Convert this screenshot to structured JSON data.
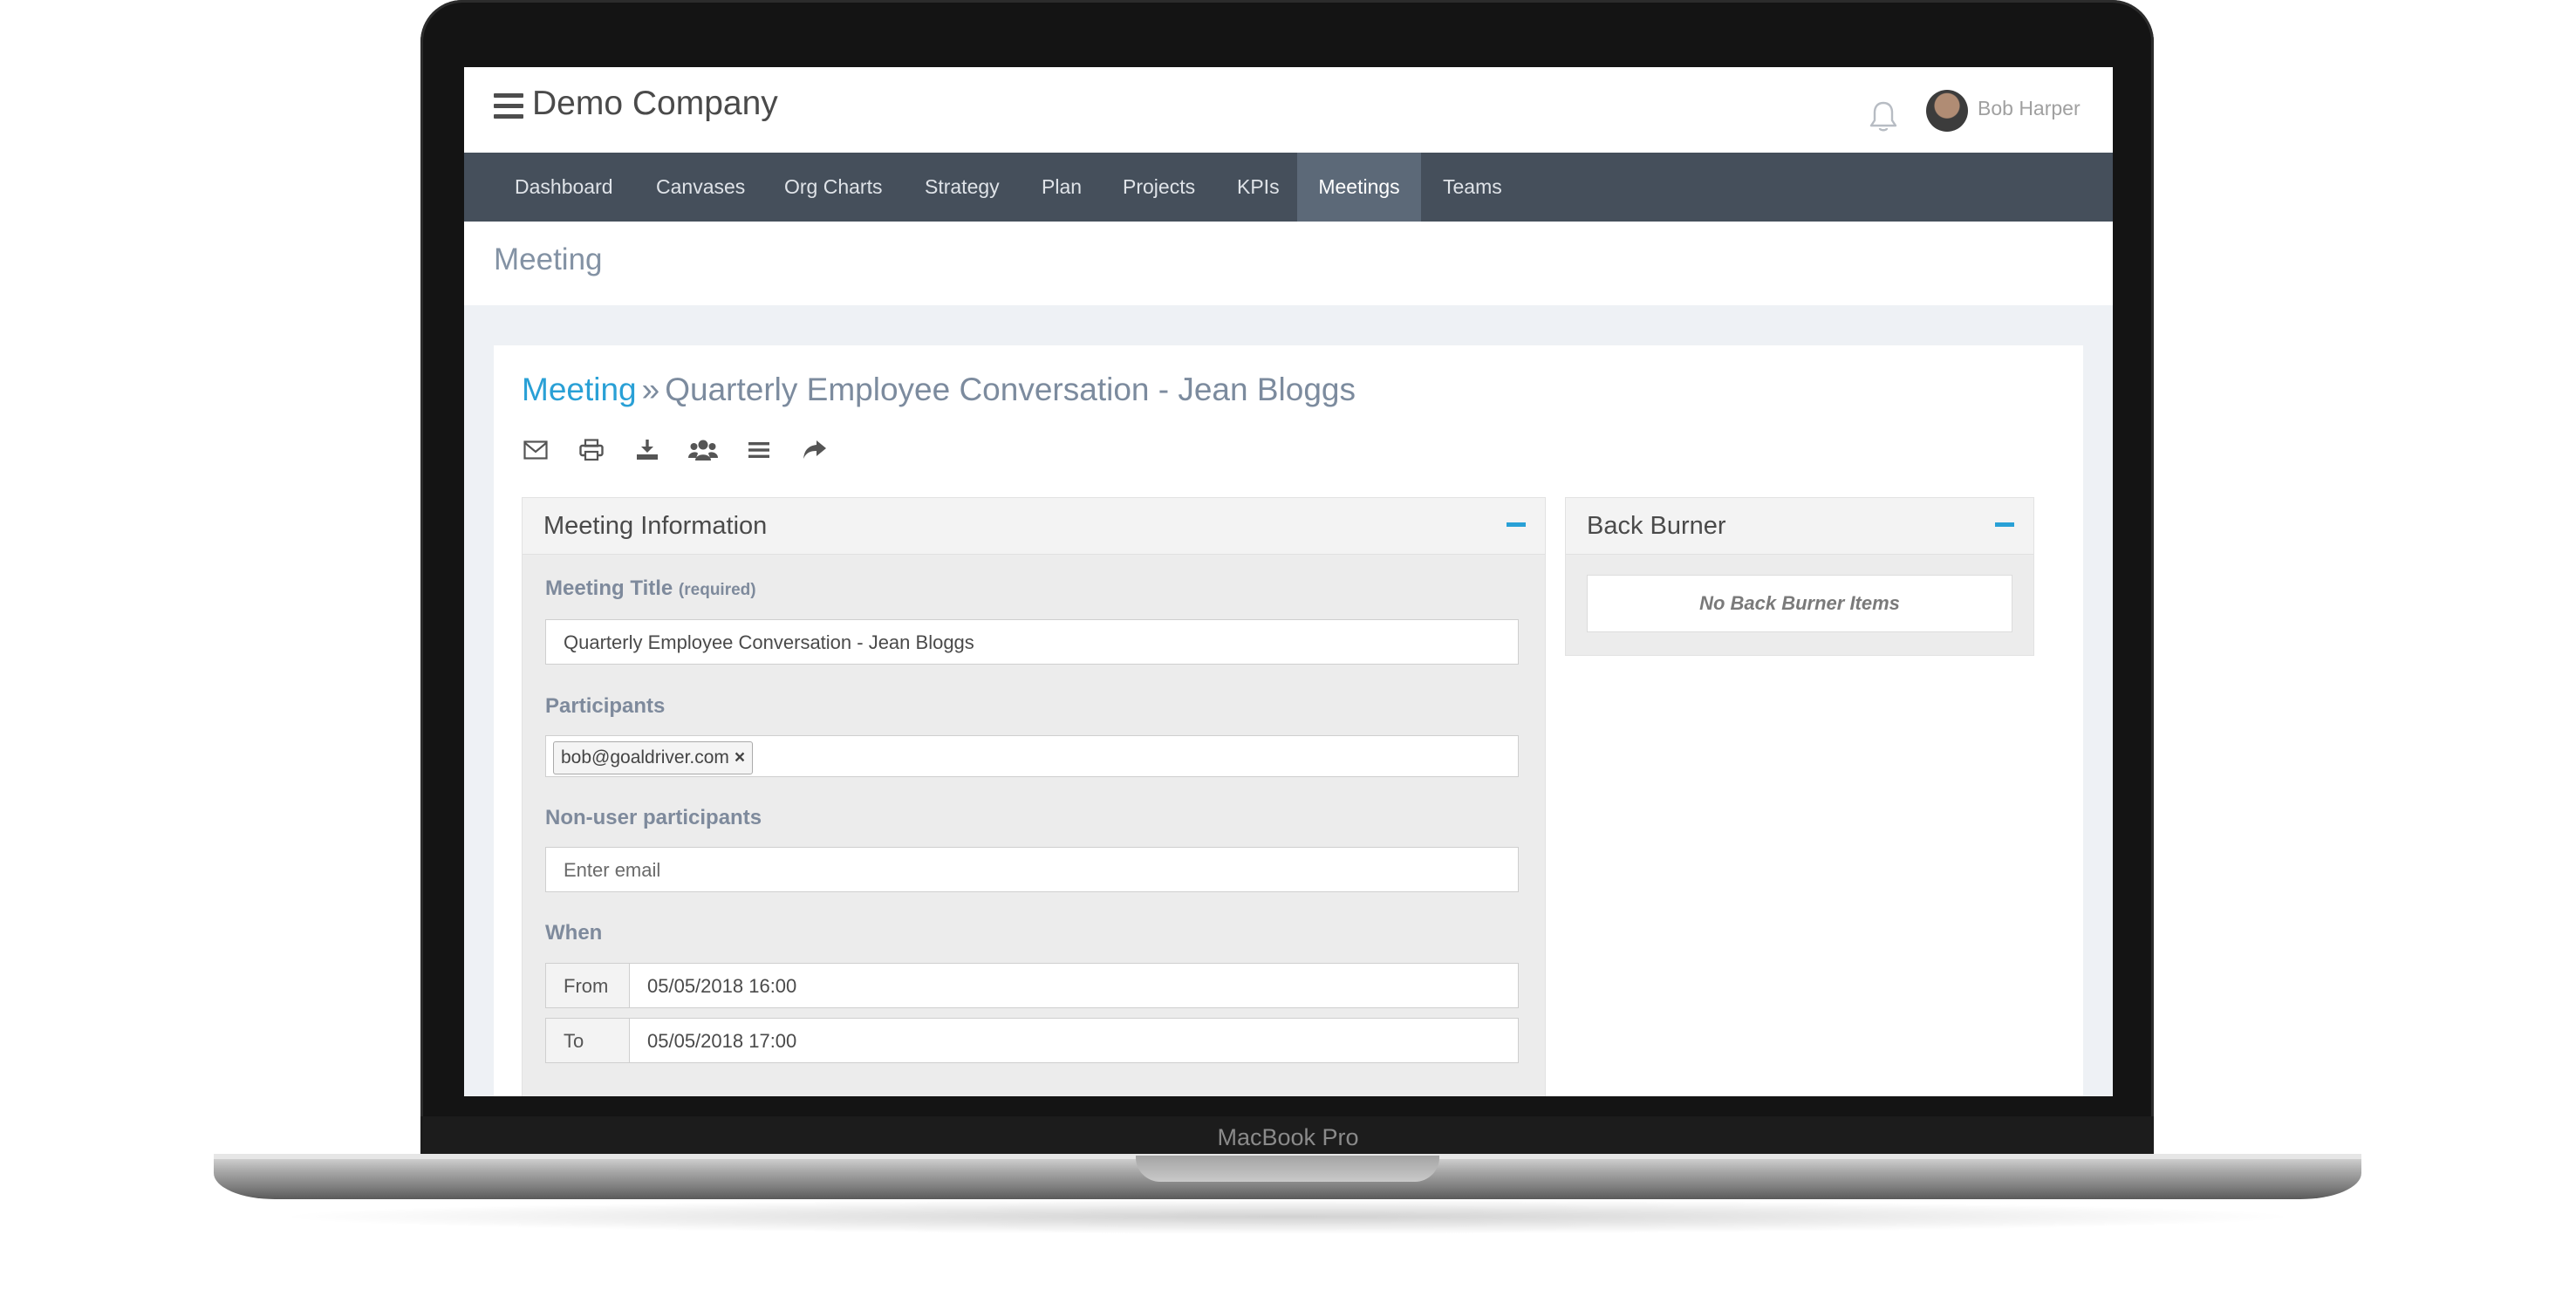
{
  "device": {
    "label": "MacBook Pro"
  },
  "header": {
    "company": "Demo Company",
    "user_name": "Bob Harper",
    "icons": {
      "menu": "hamburger-icon",
      "notifications": "bell-icon",
      "avatar": "user-avatar"
    }
  },
  "nav": {
    "items": [
      {
        "label": "Dashboard",
        "active": false
      },
      {
        "label": "Canvases",
        "active": false
      },
      {
        "label": "Org Charts",
        "active": false
      },
      {
        "label": "Strategy",
        "active": false
      },
      {
        "label": "Plan",
        "active": false
      },
      {
        "label": "Projects",
        "active": false
      },
      {
        "label": "KPIs",
        "active": false
      },
      {
        "label": "Meetings",
        "active": true
      },
      {
        "label": "Teams",
        "active": false
      }
    ]
  },
  "page": {
    "title": "Meeting"
  },
  "breadcrumb": {
    "link": "Meeting",
    "separator": "»",
    "current": "Quarterly Employee Conversation - Jean Bloggs"
  },
  "toolbar": {
    "icons": [
      "envelope-icon",
      "print-icon",
      "download-icon",
      "group-icon",
      "list-icon",
      "share-icon"
    ]
  },
  "meeting_info": {
    "title": "Meeting Information",
    "meeting_title_label": "Meeting Title",
    "meeting_title_required": "(required)",
    "meeting_title_value": "Quarterly Employee Conversation - Jean Bloggs",
    "participants_label": "Participants",
    "participants": [
      "bob@goaldriver.com"
    ],
    "participant_remove": "×",
    "nonuser_label": "Non-user participants",
    "nonuser_placeholder": "Enter email",
    "when_label": "When",
    "from_label": "From",
    "from_value": "05/05/2018 16:00",
    "to_label": "To",
    "to_value": "05/05/2018 17:00"
  },
  "back_burner": {
    "title": "Back Burner",
    "empty_text": "No Back Burner Items"
  },
  "colors": {
    "accent": "#29a0d6",
    "navbar": "#454f5b",
    "navbar_active": "#5c6978",
    "muted_text": "#7c8b9e"
  }
}
